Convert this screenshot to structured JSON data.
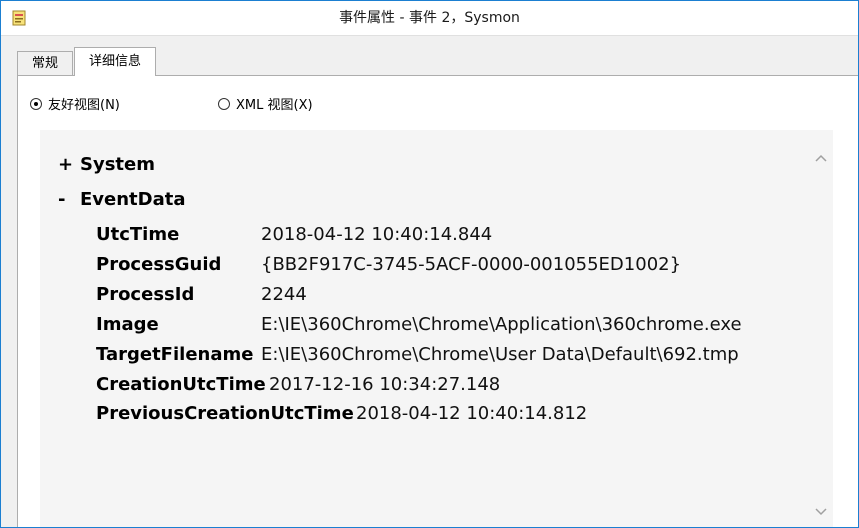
{
  "window": {
    "title": "事件属性 - 事件 2，Sysmon",
    "icon": "event-viewer-icon"
  },
  "tabs": [
    {
      "label": "常规",
      "selected": false
    },
    {
      "label": "详细信息",
      "selected": true
    }
  ],
  "view_options": {
    "friendly_label": "友好视图(N)",
    "friendly_selected": true,
    "xml_label": "XML 视图(X)",
    "xml_selected": false
  },
  "tree": {
    "system": {
      "toggle": "+",
      "label": "System"
    },
    "eventdata": {
      "toggle": "-",
      "label": "EventData"
    }
  },
  "fields": [
    {
      "name": "UtcTime",
      "value": "2018-04-12 10:40:14.844"
    },
    {
      "name": "ProcessGuid",
      "value": "{BB2F917C-3745-5ACF-0000-001055ED1002}"
    },
    {
      "name": "ProcessId",
      "value": "2244"
    },
    {
      "name": "Image",
      "value": "E:\\IE\\360Chrome\\Chrome\\Application\\360chrome.exe"
    },
    {
      "name": "TargetFilename",
      "value": "E:\\IE\\360Chrome\\Chrome\\User Data\\Default\\692.tmp"
    },
    {
      "name": "CreationUtcTime",
      "value": "2017-12-16 10:34:27.148"
    },
    {
      "name": "PreviousCreationUtcTime",
      "value": "2018-04-12 10:40:14.812"
    }
  ],
  "colors": {
    "window_border": "#1b7fd1",
    "panel_background": "#f5f5f5"
  }
}
